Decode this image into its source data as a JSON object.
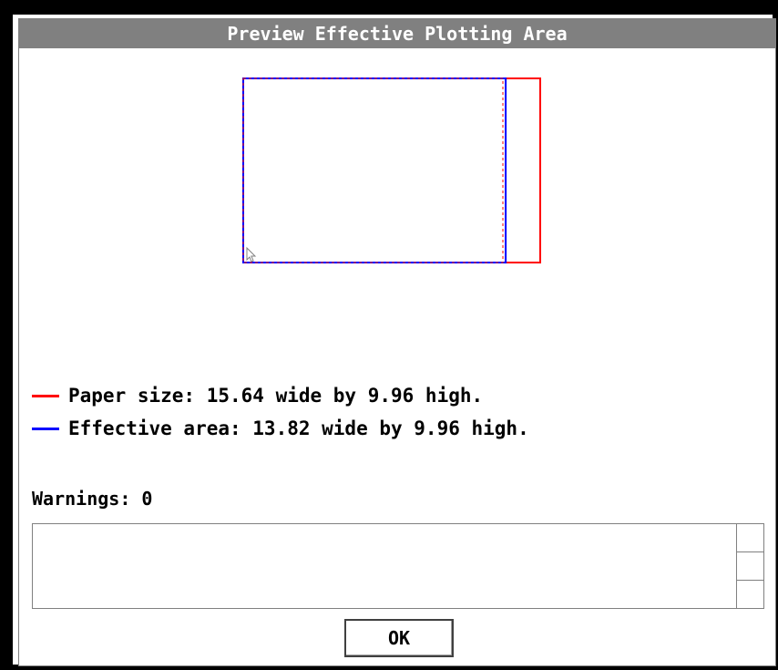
{
  "dialog": {
    "title": "Preview Effective Plotting Area"
  },
  "preview": {
    "paper_color": "#ff0000",
    "effective_color": "#0000ff",
    "paper_width": 15.64,
    "paper_height": 9.96,
    "effective_width": 13.82,
    "effective_height": 9.96
  },
  "legend": {
    "paper_text": "Paper size: 15.64 wide by 9.96 high.",
    "effective_text": "Effective area: 13.82 wide by 9.96 high."
  },
  "warnings": {
    "label": "Warnings: 0",
    "items": []
  },
  "buttons": {
    "ok_label": "OK"
  }
}
